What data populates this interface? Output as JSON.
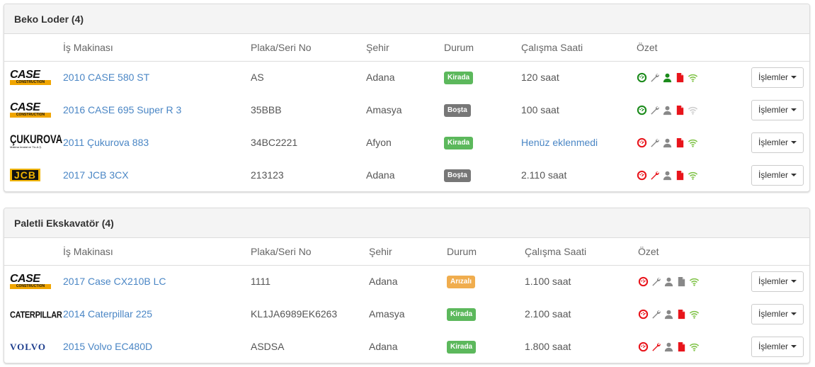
{
  "columns": [
    "İş Makinası",
    "Plaka/Seri No",
    "Şehir",
    "Durum",
    "Çalışma Saati",
    "Özet"
  ],
  "action_label": "İşlemler",
  "status_colors": {
    "Kirada": "#5cb85c",
    "Boşta": "#777777",
    "Arızalı": "#f0ad4e"
  },
  "icon_colors": {
    "green": "#1a8a1a",
    "red": "#e8141b",
    "gray": "#888888",
    "wifi_green": "#7cc142",
    "wifi_gray": "#cccccc"
  },
  "panels": [
    {
      "title": "Beko Loder (4)",
      "rows": [
        {
          "logo": "CASE",
          "logo_sub": "CONSTRUCTION",
          "name": "2010 CASE 580 ST",
          "plate": "AS",
          "city": "Adana",
          "status": "Kirada",
          "hours": "120 saat",
          "hours_is_link": false,
          "summary": {
            "gauge": "green",
            "wrench": "gray",
            "user": "green",
            "doc": "red",
            "wifi": "wifi_green"
          }
        },
        {
          "logo": "CASE",
          "logo_sub": "CONSTRUCTION",
          "name": "2016 CASE 695 Super R 3",
          "plate": "35BBB",
          "city": "Amasya",
          "status": "Boşta",
          "hours": "100 saat",
          "hours_is_link": false,
          "summary": {
            "gauge": "green",
            "wrench": "gray",
            "user": "gray",
            "doc": "red",
            "wifi": "wifi_gray"
          }
        },
        {
          "logo": "ÇUKUROVA",
          "logo_sub": "Makina İmalat ve Tic.A.Ş.",
          "name": "2011 Çukurova 883",
          "plate": "34BC2221",
          "city": "Afyon",
          "status": "Kirada",
          "hours": "Henüz eklenmedi",
          "hours_is_link": true,
          "summary": {
            "gauge": "red",
            "wrench": "gray",
            "user": "gray",
            "doc": "red",
            "wifi": "wifi_green"
          }
        },
        {
          "logo": "JCB",
          "logo_sub": "",
          "name": "2017 JCB 3CX",
          "plate": "213123",
          "city": "Adana",
          "status": "Boşta",
          "hours": "2.110 saat",
          "hours_is_link": false,
          "summary": {
            "gauge": "red",
            "wrench": "red",
            "user": "gray",
            "doc": "red",
            "wifi": "wifi_green"
          }
        }
      ]
    },
    {
      "title": "Paletli Ekskavatör (4)",
      "rows": [
        {
          "logo": "CASE",
          "logo_sub": "CONSTRUCTION",
          "name": "2017 Case CX210B LC",
          "plate": "1111",
          "city": "Adana",
          "status": "Arızalı",
          "hours": "1.100 saat",
          "hours_is_link": false,
          "summary": {
            "gauge": "red",
            "wrench": "gray",
            "user": "gray",
            "doc": "gray",
            "wifi": "wifi_green"
          }
        },
        {
          "logo": "CATERPILLAR",
          "logo_sub": "",
          "name": "2014 Caterpillar 225",
          "plate": "KL1JA6989EK6263",
          "city": "Amasya",
          "status": "Kirada",
          "hours": "2.100 saat",
          "hours_is_link": false,
          "summary": {
            "gauge": "red",
            "wrench": "gray",
            "user": "gray",
            "doc": "red",
            "wifi": "wifi_green"
          }
        },
        {
          "logo": "VOLVO",
          "logo_sub": "",
          "name": "2015 Volvo EC480D",
          "plate": "ASDSA",
          "city": "Adana",
          "status": "Kirada",
          "hours": "1.800 saat",
          "hours_is_link": false,
          "summary": {
            "gauge": "red",
            "wrench": "red",
            "user": "gray",
            "doc": "red",
            "wifi": "wifi_green"
          }
        }
      ]
    }
  ]
}
